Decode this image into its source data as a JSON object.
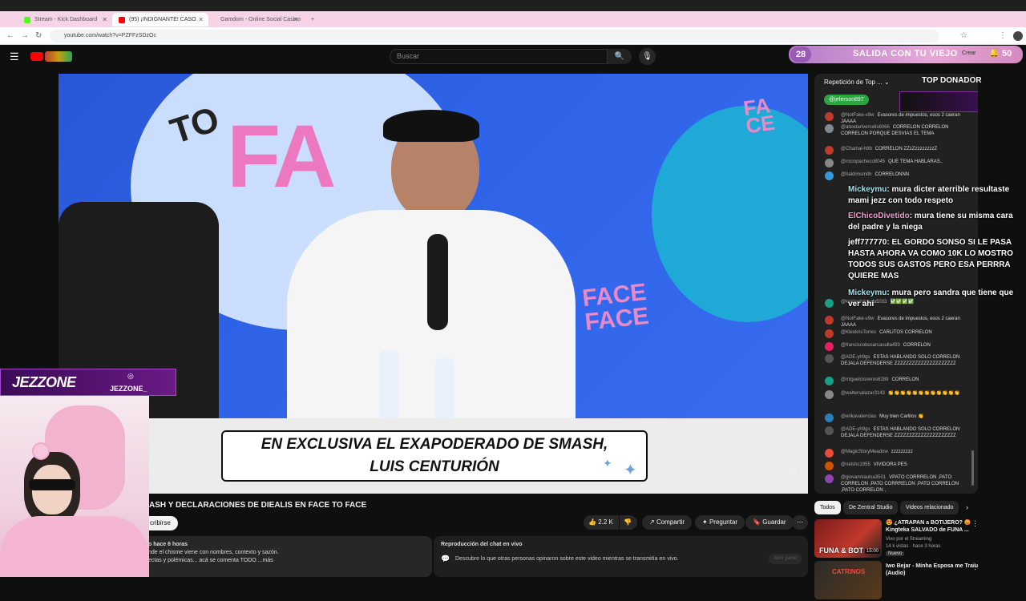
{
  "browser": {
    "tabs": [
      {
        "label": "Stream - Kick Dashboard",
        "color": "#53fc18"
      },
      {
        "label": "(95) ¡INDIGNANTE! CASO",
        "color": "#ff0000"
      },
      {
        "label": "Gamdom - Online Social Casino",
        "color": "#222222"
      }
    ],
    "url": "youtube.com/watch?v=PZFFzSDzOc"
  },
  "youtube": {
    "search_placeholder": "Buscar",
    "create_label": "Crear",
    "notif_count": "50"
  },
  "banner": {
    "count": "28",
    "text": "SALIDA CON TU VIEJO"
  },
  "video": {
    "caption": "EN EXCLUSIVA EL EXAPODERADO DE SMASH, LUIS CENTURIÓN",
    "title_fragment": "ASH Y DECLARACIONES DE DIEALIS EN FACE TO FACE"
  },
  "actions": {
    "subscribe": "cribirse",
    "likes": "2.2 K",
    "share": "Compartir",
    "ask": "Preguntar",
    "save": "Guardar"
  },
  "description": {
    "line1": "o hace 6 horas",
    "line2": "nde el chisme viene con nombres, contexto y sazón.",
    "line3": "ectas y polémicas... acá se comenta TODO   ...más"
  },
  "chat_replay": {
    "title": "Reproducción del chat en vivo",
    "text": "Descubre lo que otras personas opinaron sobre este video mientras se transmitía en vivo.",
    "button": "Abrir panel"
  },
  "chat": {
    "header": "Repetición de Top ...",
    "badge_user": "@jeferson897",
    "top_donor": "TOP DONADOR",
    "messages": [
      {
        "author": "@NotFake-v9w",
        "text": "Evasores de impuestos, esos 2 caeran JAAAA",
        "color": "#c0392b"
      },
      {
        "author": "@alexdarivercelis6066",
        "text": "CORRELON CORRELON CORRELON PORQUE DESVIAS EL TEMA",
        "color": "#7f8c8d"
      },
      {
        "author": "@Chamal-h9b",
        "text": "CORRELON ZZzZzzzzzzzzZ",
        "color": "#c0392b"
      },
      {
        "author": "@rociopacheco8045",
        "text": "QUE TEMA HABLARAS..",
        "color": "#888888"
      },
      {
        "author": "@haldrinsmith",
        "text": "CORRELONNN",
        "color": "#3498db"
      },
      {
        "author": "@kimberlyloyola5033",
        "text": "✅✅✅✅",
        "color": "#16a085"
      },
      {
        "author": "@NotFake-v9w",
        "text": "Evasores de impuestos, esos 2 caeran JAAAA",
        "color": "#c0392b"
      },
      {
        "author": "@KleokrisTorres",
        "text": "CARLITOS CORRELON",
        "color": "#c0392b"
      },
      {
        "author": "@franciscobusarcasulla493",
        "text": "CORRELON",
        "color": "#e91e63"
      },
      {
        "author": "@ADE-yh9gs",
        "text": "ESTAS HABLANDO SOLO CORRELON DEJALA DEFENDERSE ZZZZZZZZZZZZZZZZZZZZZ",
        "color": "#555555"
      },
      {
        "author": "@miguelcisneros6289",
        "text": "CORRELON",
        "color": "#16a085"
      },
      {
        "author": "@waltersalazar3143",
        "text": "👏👏👏👏👏👏👏👏👏👏👏👏",
        "color": "#888888"
      },
      {
        "author": "@erikavalencias",
        "text": "Muy bien Carlitos 👏",
        "color": "#2980b9"
      },
      {
        "author": "@ADE-yh9gs",
        "text": "ESTAS HABLANDO SOLO CORRELON DEJALA DEFENDERSE ZZZZZZZZZZZZZZZZZZZZZ",
        "color": "#555555"
      },
      {
        "author": "@MagicStoryMeadow",
        "text": "zzzzzzzzz",
        "color": "#e74c3c"
      },
      {
        "author": "@nelshc1955",
        "text": "VIVIDORA PES",
        "color": "#d35400"
      },
      {
        "author": "@giovanniaulsa3501",
        "text": "VPATO CORRRELON ,PATO CORRELON ,PATO CORRRELON ,PATO CORRELON ,PATO CORRELON ,",
        "color": "#8e44ad"
      }
    ]
  },
  "overlay_chat": [
    {
      "name": "Mickeymu",
      "text": ": mura dicter aterrible resultaste mami jezz con todo respeto",
      "name_style": "blue"
    },
    {
      "name": "ElChicoDivetido",
      "text": ": mura tiene su misma cara del padre y la niega",
      "name_style": "pink"
    },
    {
      "name": "jeff777770",
      "text": ": EL GORDO SONSO SI LE PASA HASTA AHORA VA COMO 10K LO MOSTRO TODOS SUS GASTOS PERO ESA PERRRA QUIERE MAS",
      "name_style": "white"
    },
    {
      "name": "Mickeymu",
      "text": ": mura pero sandra que tiene que ver ahí",
      "name_style": "blue"
    }
  ],
  "recs": {
    "chips": [
      "Todos",
      "De Zentral Studio",
      "Videos relacionado"
    ],
    "items": [
      {
        "title": "😍 ¿ATRAPAN a BOTIJERO? 😡 Kingteka SALVADO de FUNA ...",
        "channel": "Vivo por el Streaming",
        "meta": "14 k vistas · hace 3 horas",
        "badge": "Nuevo",
        "thumb_label": "FUNA & BOT",
        "duration": "15:00"
      },
      {
        "title": "Iwo Bejar - Minha Esposa me Traiu (Audio)",
        "channel": "",
        "meta": "",
        "badge": "",
        "thumb_label": "CATRINOS",
        "duration": ""
      }
    ]
  },
  "streamer": {
    "logo": "JEZZONE",
    "handle": "JEZZONE_"
  }
}
